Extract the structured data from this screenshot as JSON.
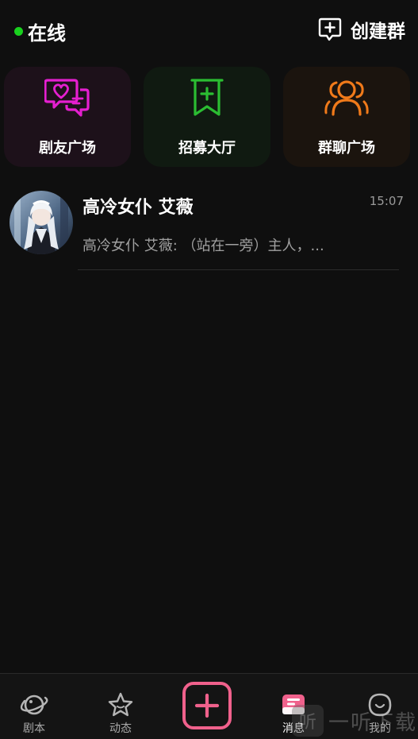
{
  "header": {
    "status_label": "在线",
    "create_label": "创建群"
  },
  "tiles": [
    {
      "label": "剧友广场",
      "icon": "chat-heart-icon",
      "color": "#e51fd0"
    },
    {
      "label": "招募大厅",
      "icon": "bookmark-plus-icon",
      "color": "#2bbd32"
    },
    {
      "label": "群聊广场",
      "icon": "group-icon",
      "color": "#f07a1a"
    }
  ],
  "chats": [
    {
      "name": "高冷女仆 艾薇",
      "time": "15:07",
      "preview": "高冷女仆 艾薇: （站在一旁）主人，..."
    }
  ],
  "tabbar": {
    "items": [
      {
        "label": "剧本",
        "icon": "planet-icon"
      },
      {
        "label": "动态",
        "icon": "star-icon"
      },
      {
        "label": "",
        "icon": "plus-icon"
      },
      {
        "label": "消息",
        "icon": "message-icon",
        "active": true
      },
      {
        "label": "我的",
        "icon": "profile-icon"
      }
    ]
  },
  "watermark": {
    "glyph": "听",
    "text": "一听下载"
  },
  "colors": {
    "online": "#19d11e",
    "accent": "#f0618c",
    "background": "#0f0f0f"
  }
}
